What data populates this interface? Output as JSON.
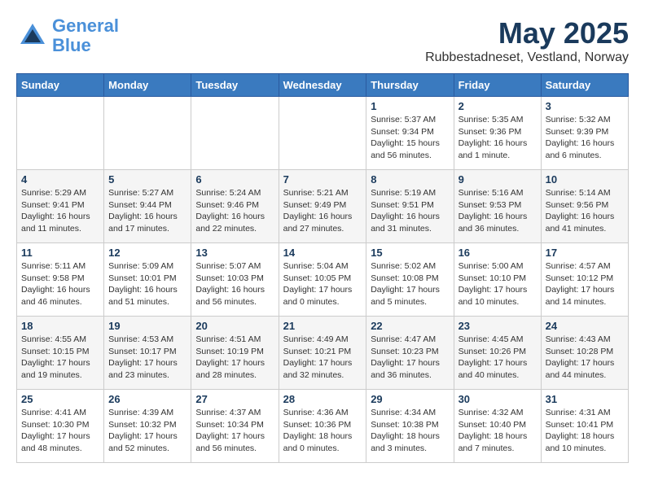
{
  "header": {
    "logo_line1": "General",
    "logo_line2": "Blue",
    "month": "May 2025",
    "location": "Rubbestadneset, Vestland, Norway"
  },
  "days_of_week": [
    "Sunday",
    "Monday",
    "Tuesday",
    "Wednesday",
    "Thursday",
    "Friday",
    "Saturday"
  ],
  "weeks": [
    [
      {
        "day": "",
        "info": ""
      },
      {
        "day": "",
        "info": ""
      },
      {
        "day": "",
        "info": ""
      },
      {
        "day": "",
        "info": ""
      },
      {
        "day": "1",
        "info": "Sunrise: 5:37 AM\nSunset: 9:34 PM\nDaylight: 15 hours\nand 56 minutes."
      },
      {
        "day": "2",
        "info": "Sunrise: 5:35 AM\nSunset: 9:36 PM\nDaylight: 16 hours\nand 1 minute."
      },
      {
        "day": "3",
        "info": "Sunrise: 5:32 AM\nSunset: 9:39 PM\nDaylight: 16 hours\nand 6 minutes."
      }
    ],
    [
      {
        "day": "4",
        "info": "Sunrise: 5:29 AM\nSunset: 9:41 PM\nDaylight: 16 hours\nand 11 minutes."
      },
      {
        "day": "5",
        "info": "Sunrise: 5:27 AM\nSunset: 9:44 PM\nDaylight: 16 hours\nand 17 minutes."
      },
      {
        "day": "6",
        "info": "Sunrise: 5:24 AM\nSunset: 9:46 PM\nDaylight: 16 hours\nand 22 minutes."
      },
      {
        "day": "7",
        "info": "Sunrise: 5:21 AM\nSunset: 9:49 PM\nDaylight: 16 hours\nand 27 minutes."
      },
      {
        "day": "8",
        "info": "Sunrise: 5:19 AM\nSunset: 9:51 PM\nDaylight: 16 hours\nand 31 minutes."
      },
      {
        "day": "9",
        "info": "Sunrise: 5:16 AM\nSunset: 9:53 PM\nDaylight: 16 hours\nand 36 minutes."
      },
      {
        "day": "10",
        "info": "Sunrise: 5:14 AM\nSunset: 9:56 PM\nDaylight: 16 hours\nand 41 minutes."
      }
    ],
    [
      {
        "day": "11",
        "info": "Sunrise: 5:11 AM\nSunset: 9:58 PM\nDaylight: 16 hours\nand 46 minutes."
      },
      {
        "day": "12",
        "info": "Sunrise: 5:09 AM\nSunset: 10:01 PM\nDaylight: 16 hours\nand 51 minutes."
      },
      {
        "day": "13",
        "info": "Sunrise: 5:07 AM\nSunset: 10:03 PM\nDaylight: 16 hours\nand 56 minutes."
      },
      {
        "day": "14",
        "info": "Sunrise: 5:04 AM\nSunset: 10:05 PM\nDaylight: 17 hours\nand 0 minutes."
      },
      {
        "day": "15",
        "info": "Sunrise: 5:02 AM\nSunset: 10:08 PM\nDaylight: 17 hours\nand 5 minutes."
      },
      {
        "day": "16",
        "info": "Sunrise: 5:00 AM\nSunset: 10:10 PM\nDaylight: 17 hours\nand 10 minutes."
      },
      {
        "day": "17",
        "info": "Sunrise: 4:57 AM\nSunset: 10:12 PM\nDaylight: 17 hours\nand 14 minutes."
      }
    ],
    [
      {
        "day": "18",
        "info": "Sunrise: 4:55 AM\nSunset: 10:15 PM\nDaylight: 17 hours\nand 19 minutes."
      },
      {
        "day": "19",
        "info": "Sunrise: 4:53 AM\nSunset: 10:17 PM\nDaylight: 17 hours\nand 23 minutes."
      },
      {
        "day": "20",
        "info": "Sunrise: 4:51 AM\nSunset: 10:19 PM\nDaylight: 17 hours\nand 28 minutes."
      },
      {
        "day": "21",
        "info": "Sunrise: 4:49 AM\nSunset: 10:21 PM\nDaylight: 17 hours\nand 32 minutes."
      },
      {
        "day": "22",
        "info": "Sunrise: 4:47 AM\nSunset: 10:23 PM\nDaylight: 17 hours\nand 36 minutes."
      },
      {
        "day": "23",
        "info": "Sunrise: 4:45 AM\nSunset: 10:26 PM\nDaylight: 17 hours\nand 40 minutes."
      },
      {
        "day": "24",
        "info": "Sunrise: 4:43 AM\nSunset: 10:28 PM\nDaylight: 17 hours\nand 44 minutes."
      }
    ],
    [
      {
        "day": "25",
        "info": "Sunrise: 4:41 AM\nSunset: 10:30 PM\nDaylight: 17 hours\nand 48 minutes."
      },
      {
        "day": "26",
        "info": "Sunrise: 4:39 AM\nSunset: 10:32 PM\nDaylight: 17 hours\nand 52 minutes."
      },
      {
        "day": "27",
        "info": "Sunrise: 4:37 AM\nSunset: 10:34 PM\nDaylight: 17 hours\nand 56 minutes."
      },
      {
        "day": "28",
        "info": "Sunrise: 4:36 AM\nSunset: 10:36 PM\nDaylight: 18 hours\nand 0 minutes."
      },
      {
        "day": "29",
        "info": "Sunrise: 4:34 AM\nSunset: 10:38 PM\nDaylight: 18 hours\nand 3 minutes."
      },
      {
        "day": "30",
        "info": "Sunrise: 4:32 AM\nSunset: 10:40 PM\nDaylight: 18 hours\nand 7 minutes."
      },
      {
        "day": "31",
        "info": "Sunrise: 4:31 AM\nSunset: 10:41 PM\nDaylight: 18 hours\nand 10 minutes."
      }
    ]
  ]
}
